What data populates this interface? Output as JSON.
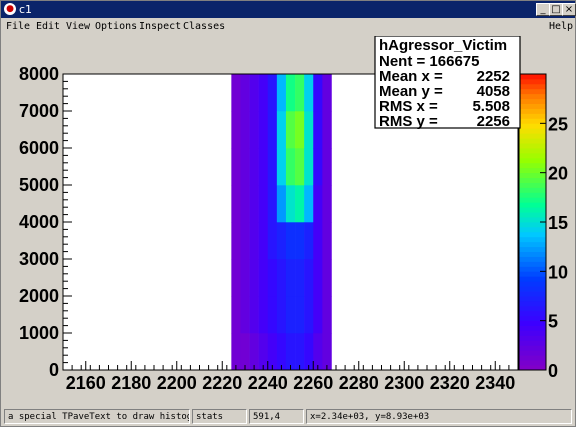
{
  "window": {
    "title": "c1",
    "minimize": "_",
    "maximize": "□",
    "close": "×"
  },
  "menu": [
    "File",
    "Edit",
    "View",
    "Options",
    "Inspect",
    "Classes"
  ],
  "help": "Help",
  "stats": {
    "name": "hAgressor_Victim",
    "lines": [
      {
        "label": "Nent = 166675",
        "value": ""
      },
      {
        "label": "Mean x =",
        "value": "2252"
      },
      {
        "label": "Mean y =",
        "value": "4058"
      },
      {
        "label": "RMS x =",
        "value": "5.508"
      },
      {
        "label": "RMS y =",
        "value": "2256"
      }
    ]
  },
  "palette_ticks": [
    "0",
    "5",
    "10",
    "15",
    "20",
    "25"
  ],
  "colors": {
    "frame": "#000000",
    "pad": "#d4d0c8",
    "titlebar": "#0a246a"
  },
  "chart_data": {
    "type": "heatmap",
    "title": "",
    "xlabel": "",
    "ylabel": "",
    "xlim": [
      2150,
      2350
    ],
    "ylim": [
      0,
      8000
    ],
    "zlim": [
      0,
      30
    ],
    "x_ticks": [
      2160,
      2180,
      2200,
      2220,
      2240,
      2260,
      2280,
      2300,
      2320,
      2340
    ],
    "y_ticks": [
      0,
      1000,
      2000,
      3000,
      4000,
      5000,
      6000,
      7000,
      8000
    ],
    "z_ticks": [
      0,
      5,
      10,
      15,
      20,
      25
    ],
    "bin_columns": [
      {
        "x": 2226,
        "counts": [
          1,
          1,
          1,
          1,
          1,
          1,
          1,
          1
        ]
      },
      {
        "x": 2230,
        "counts": [
          1,
          2,
          2,
          2,
          2,
          2,
          2,
          2
        ]
      },
      {
        "x": 2234,
        "counts": [
          2,
          3,
          3,
          3,
          3,
          3,
          3,
          3
        ]
      },
      {
        "x": 2238,
        "counts": [
          3,
          4,
          4,
          4,
          4,
          4,
          4,
          4
        ]
      },
      {
        "x": 2242,
        "counts": [
          4,
          5,
          5,
          6,
          6,
          6,
          6,
          6
        ]
      },
      {
        "x": 2246,
        "counts": [
          5,
          6,
          6,
          7,
          12,
          14,
          14,
          13
        ]
      },
      {
        "x": 2250,
        "counts": [
          6,
          7,
          7,
          8,
          15,
          18,
          19,
          17
        ]
      },
      {
        "x": 2254,
        "counts": [
          6,
          7,
          7,
          8,
          16,
          19,
          20,
          18
        ]
      },
      {
        "x": 2258,
        "counts": [
          5,
          6,
          6,
          7,
          13,
          15,
          15,
          14
        ]
      },
      {
        "x": 2262,
        "counts": [
          3,
          4,
          4,
          4,
          4,
          5,
          5,
          5
        ]
      },
      {
        "x": 2266,
        "counts": [
          2,
          2,
          2,
          2,
          2,
          2,
          2,
          2
        ]
      }
    ],
    "y_bin_centers": [
      500,
      1500,
      2500,
      3500,
      4500,
      5500,
      6500,
      7500
    ]
  },
  "status": {
    "object": "a special TPaveText to draw histogram",
    "name": "stats",
    "value": "591,4",
    "coords": "x=2.34e+03, y=8.93e+03"
  }
}
